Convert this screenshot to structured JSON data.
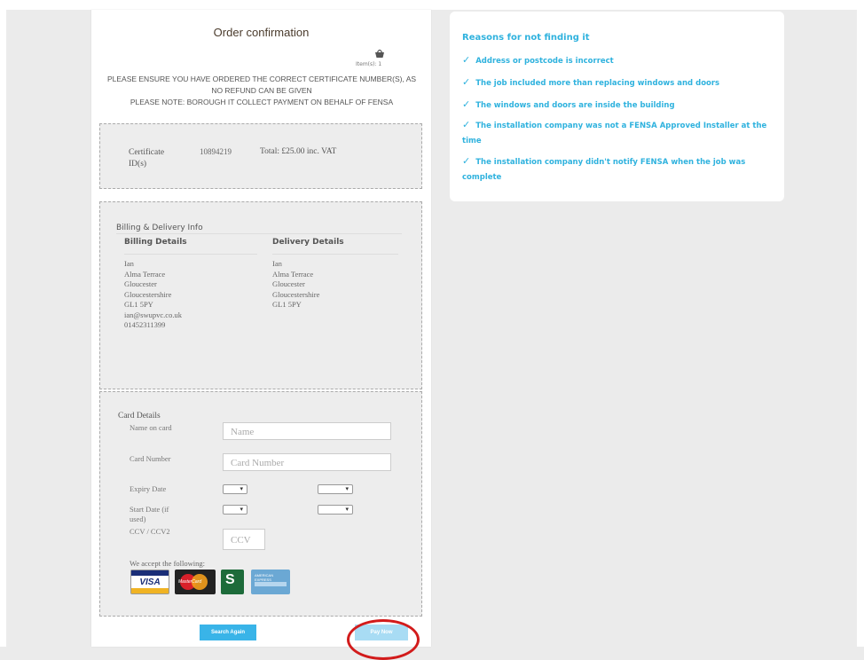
{
  "order": {
    "title": "Order confirmation",
    "items_label": "Item(s): 1",
    "notice_line1": "PLEASE ENSURE YOU HAVE ORDERED THE CORRECT CERTIFICATE NUMBER(S), AS NO REFUND CAN BE GIVEN",
    "notice_line2": "PLEASE NOTE: BOROUGH IT COLLECT PAYMENT ON BEHALF OF FENSA"
  },
  "certificate": {
    "label": "Certificate ID(s)",
    "id": "10894219",
    "total": "Total: £25.00 inc. VAT"
  },
  "billing_delivery": {
    "heading": "Billing & Delivery Info",
    "billing": {
      "heading": "Billing Details",
      "lines": [
        "Ian",
        "Alma Terrace",
        "Gloucester",
        "Gloucestershire",
        "GL1 5PY",
        "ian@swupvc.co.uk",
        "01452311399"
      ]
    },
    "delivery": {
      "heading": "Delivery Details",
      "lines": [
        "Ian",
        "Alma Terrace",
        "Gloucester",
        "Gloucestershire",
        "GL1 5PY"
      ]
    }
  },
  "card": {
    "heading": "Card Details",
    "name_label": "Name on card",
    "name_placeholder": "Name",
    "number_label": "Card Number",
    "number_placeholder": "Card Number",
    "expiry_label": "Expiry Date",
    "start_label": "Start Date (if used)",
    "ccv_label": "CCV / CCV2",
    "ccv_placeholder": "CCV",
    "accept_label": "We accept the following:",
    "visa_text": "VISA",
    "mastercard_text": "MasterCard",
    "maestro_text": "S",
    "amex_text": "AMERICAN EXPRESS"
  },
  "buttons": {
    "search_again": "Search Again",
    "pay_now": "Pay Now"
  },
  "reasons": {
    "title": "Reasons for not finding it",
    "items": [
      "Address or postcode is incorrect",
      "The job included more than replacing windows and doors",
      "The windows and doors are inside the building",
      "The installation company was not a FENSA Approved Installer at the time",
      "The installation company didn't notify FENSA when the job was complete"
    ]
  },
  "colors": {
    "accent": "#39b4e8",
    "reason_text": "#2fb2de",
    "highlight_circle": "#d21b1b"
  }
}
